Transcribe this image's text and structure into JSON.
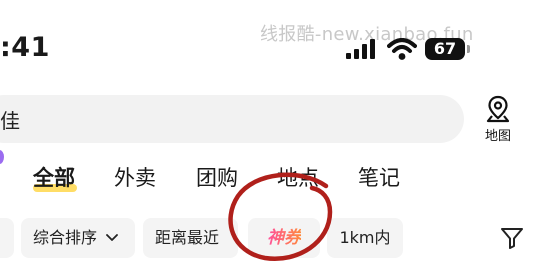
{
  "status_bar": {
    "time": ":41",
    "battery": "67",
    "watermark": "线报酷-new.xianbao.fun"
  },
  "search": {
    "text": "佳"
  },
  "map_button": {
    "label": "地图",
    "icon": "map-pin-icon"
  },
  "tabs": [
    {
      "label": "全部",
      "active": true
    },
    {
      "label": "外卖",
      "active": false
    },
    {
      "label": "团购",
      "active": false
    },
    {
      "label": "地点",
      "active": false
    },
    {
      "label": "笔记",
      "active": false
    }
  ],
  "filters": {
    "sort_label": "综合排序",
    "distance_label": "距离最近",
    "coupon_label": "神券",
    "range_label": "1km内",
    "filter_icon": "funnel-icon"
  },
  "colors": {
    "tab_underline": "#ffd233",
    "annotation_circle": "#b0201b",
    "coupon_gradient_start": "#ff4f9c",
    "coupon_gradient_end": "#ff8a3d"
  }
}
